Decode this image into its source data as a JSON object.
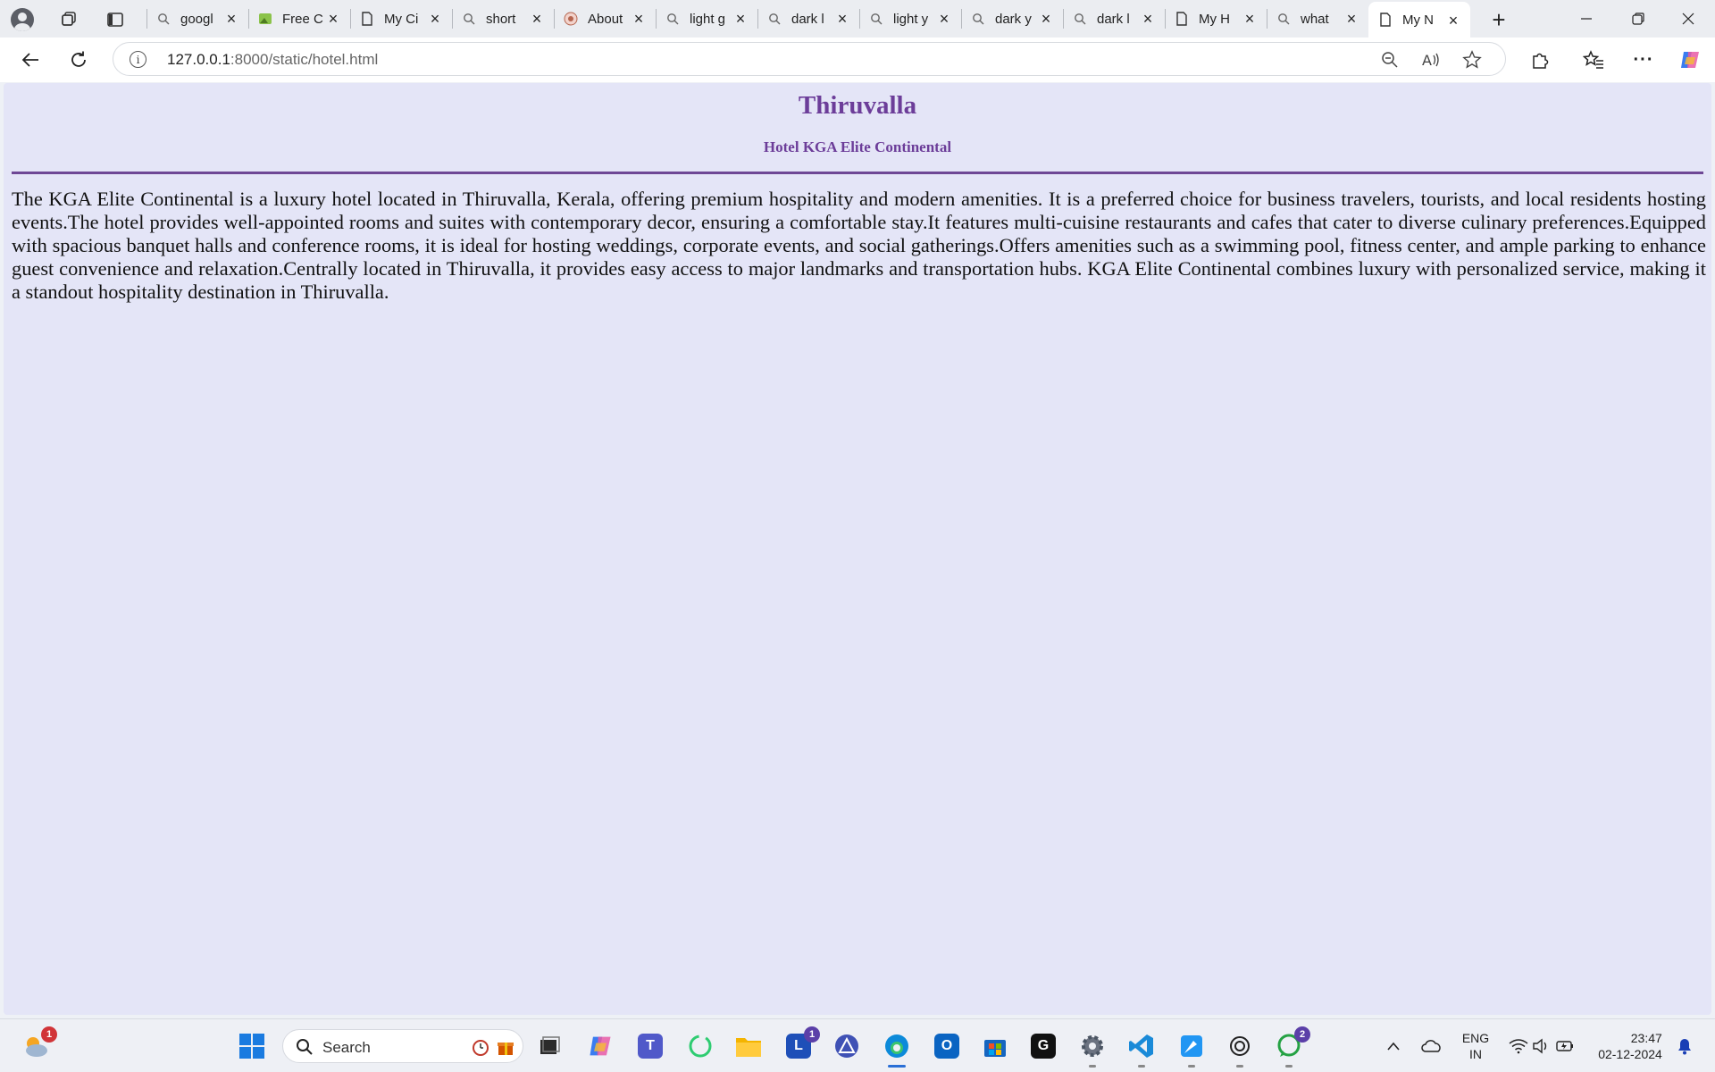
{
  "browser": {
    "tabs": [
      {
        "label": "googl",
        "icon": "search-icon"
      },
      {
        "label": "Free C",
        "icon": "image-icon"
      },
      {
        "label": "My Ci",
        "icon": "page-icon"
      },
      {
        "label": "short",
        "icon": "search-icon"
      },
      {
        "label": "About",
        "icon": "site-icon"
      },
      {
        "label": "light g",
        "icon": "search-icon"
      },
      {
        "label": "dark l",
        "icon": "search-icon"
      },
      {
        "label": "light y",
        "icon": "search-icon"
      },
      {
        "label": "dark y",
        "icon": "search-icon"
      },
      {
        "label": "dark l",
        "icon": "search-icon"
      },
      {
        "label": "My H",
        "icon": "page-icon"
      },
      {
        "label": "what",
        "icon": "search-icon"
      },
      {
        "label": "My N",
        "icon": "page-icon",
        "active": true
      }
    ],
    "address": {
      "host": "127.0.0.1",
      "path": ":8000/static/hotel.html"
    }
  },
  "page": {
    "title": "Thiruvalla",
    "subtitle": "Hotel KGA Elite Continental",
    "body": "The KGA Elite Continental is a luxury hotel located in Thiruvalla, Kerala, offering premium hospitality and modern amenities. It is a preferred choice for business travelers, tourists, and local residents hosting events.The hotel provides well-appointed rooms and suites with contemporary decor, ensuring a comfortable stay.It features multi-cuisine restaurants and cafes that cater to diverse culinary preferences.Equipped with spacious banquet halls and conference rooms, it is ideal for hosting weddings, corporate events, and social gatherings.Offers amenities such as a swimming pool, fitness center, and ample parking to enhance guest convenience and relaxation.Centrally located in Thiruvalla, it provides easy access to major landmarks and transportation hubs. KGA Elite Continental combines luxury with personalized service, making it a standout hospitality destination in Thiruvalla.",
    "colors": {
      "background": "#e4e5f7",
      "heading": "#6c3d99",
      "rule": "#6e4795"
    }
  },
  "taskbar": {
    "search_label": "Search",
    "weather_badge": "1",
    "teams_l_badge": "1",
    "whatsapp_badge": "2",
    "language_line1": "ENG",
    "language_line2": "IN",
    "time": "23:47",
    "date": "02-12-2024"
  }
}
